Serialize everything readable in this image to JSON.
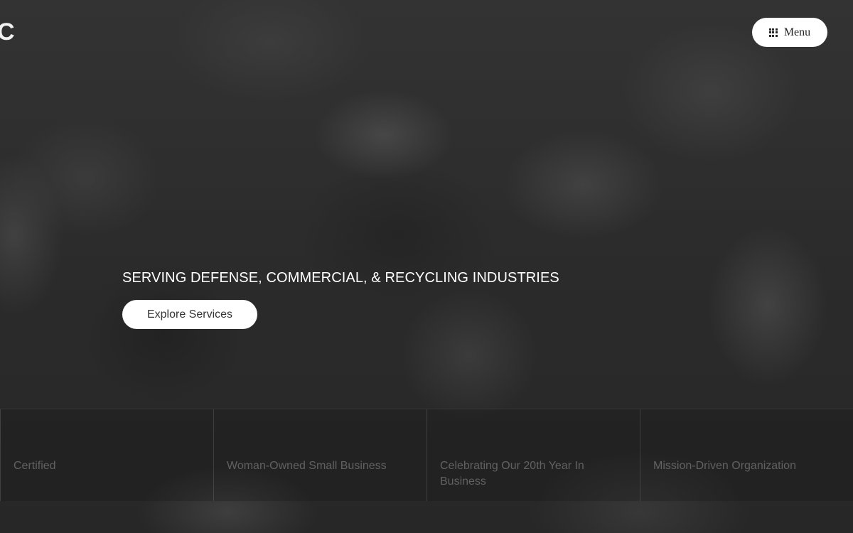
{
  "header": {
    "logo_fragment": "C",
    "menu_label": "Menu",
    "menu_icon": "grid-icon"
  },
  "hero": {
    "tagline": "SERVING DEFENSE, COMMERCIAL, & RECYCLING INDUSTRIES",
    "cta_label": "Explore Services"
  },
  "features": [
    {
      "label": "Certified"
    },
    {
      "label": "Woman-Owned Small Business"
    },
    {
      "label": "Celebrating Our 20th Year In Business"
    },
    {
      "label": "Mission-Driven Organization"
    }
  ],
  "colors": {
    "background": "#2e2e2e",
    "button_bg": "#ffffff",
    "text": "#ffffff"
  }
}
